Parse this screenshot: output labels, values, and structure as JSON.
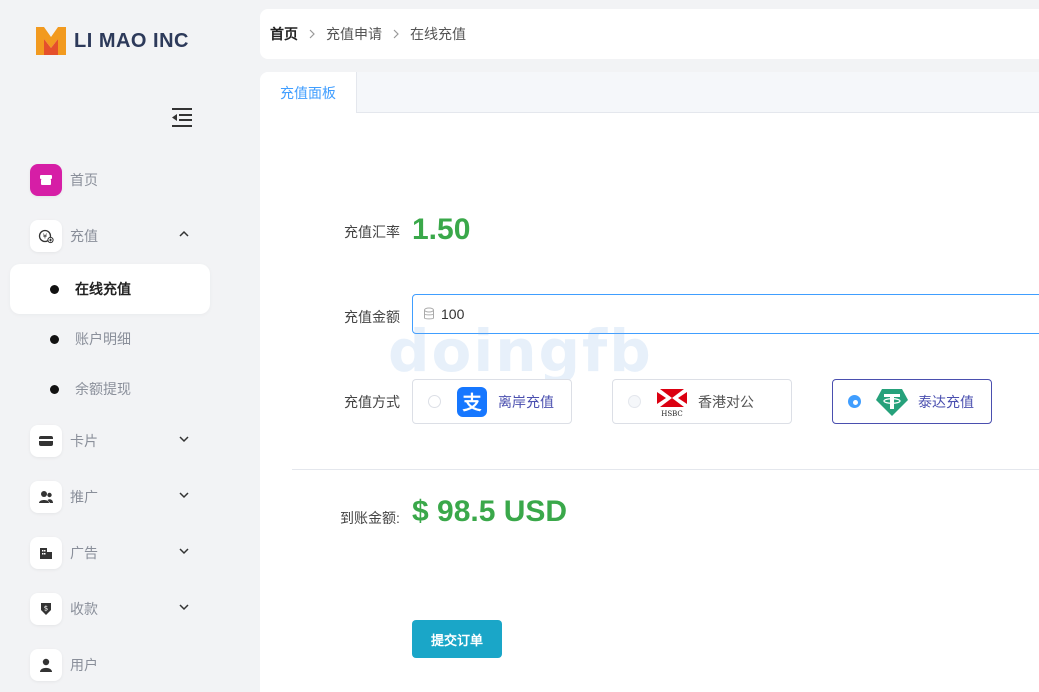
{
  "brand": {
    "name": "LI MAO INC"
  },
  "sidebar": {
    "items": [
      {
        "label": "首页"
      },
      {
        "label": "充值"
      },
      {
        "label": "卡片"
      },
      {
        "label": "推广"
      },
      {
        "label": "广告"
      },
      {
        "label": "收款"
      },
      {
        "label": "用户"
      }
    ],
    "recharge_sub": [
      {
        "label": "在线充值"
      },
      {
        "label": "账户明细"
      },
      {
        "label": "余额提现"
      }
    ]
  },
  "breadcrumb": [
    "首页",
    "充值申请",
    "在线充值"
  ],
  "panel": {
    "tab_label": "充值面板",
    "rate_label": "充值汇率",
    "rate_value": "1.50",
    "amount_label": "充值金额",
    "amount_value": "100",
    "method_label": "充值方式",
    "methods": [
      {
        "label": "离岸充值"
      },
      {
        "label": "香港对公"
      },
      {
        "label": "泰达充值"
      }
    ],
    "receive_label": "到账金额:",
    "receive_value": "$ 98.5 USD",
    "submit_label": "提交订单",
    "watermark": "doingfb"
  },
  "colors": {
    "accent": "#409eff",
    "value_green": "#3aa84a",
    "submit": "#1aa6c8",
    "home_icon": "#d61ea6"
  }
}
